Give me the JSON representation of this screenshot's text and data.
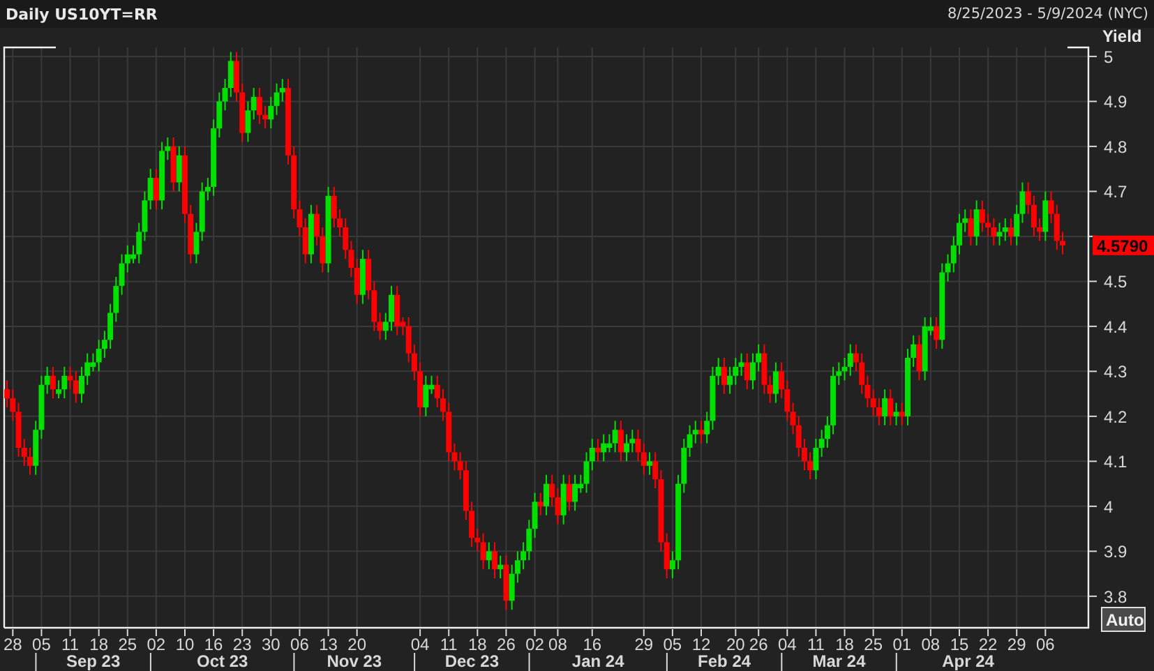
{
  "header": {
    "title": "Daily US10YT=RR",
    "range": "8/25/2023 - 5/9/2024 (NYC)"
  },
  "autoscale_button": "Auto",
  "chart_data": {
    "type": "candlestick",
    "ylabel": "Yield",
    "ylim": [
      3.73,
      5.02
    ],
    "grid": true,
    "yticks": [
      {
        "value": 3.8,
        "label": "3.8"
      },
      {
        "value": 3.9,
        "label": "3.9"
      },
      {
        "value": 4.0,
        "label": "4"
      },
      {
        "value": 4.1,
        "label": "4.1"
      },
      {
        "value": 4.2,
        "label": "4.2"
      },
      {
        "value": 4.3,
        "label": "4.3"
      },
      {
        "value": 4.4,
        "label": "4.4"
      },
      {
        "value": 4.5,
        "label": "4.5"
      },
      {
        "value": 4.7,
        "label": "4.7"
      },
      {
        "value": 4.8,
        "label": "4.8"
      },
      {
        "value": 4.9,
        "label": "4.9"
      },
      {
        "value": 5.0,
        "label": "5"
      }
    ],
    "categories": [
      null,
      "28",
      null,
      null,
      null,
      null,
      "05",
      null,
      null,
      null,
      null,
      "11",
      null,
      null,
      null,
      null,
      "18",
      null,
      null,
      null,
      null,
      "25",
      null,
      null,
      null,
      null,
      "02",
      null,
      null,
      null,
      null,
      "10",
      null,
      null,
      null,
      null,
      "16",
      null,
      null,
      null,
      null,
      "23",
      null,
      null,
      null,
      null,
      "30",
      null,
      null,
      null,
      null,
      "06",
      null,
      null,
      null,
      null,
      "13",
      null,
      null,
      null,
      null,
      "20",
      null,
      null,
      null,
      null,
      null,
      null,
      null,
      null,
      null,
      null,
      "04",
      null,
      null,
      null,
      null,
      "11",
      null,
      null,
      null,
      null,
      "18",
      null,
      null,
      null,
      null,
      "26",
      null,
      null,
      null,
      null,
      "02",
      null,
      null,
      null,
      "08",
      null,
      null,
      null,
      null,
      null,
      "16",
      null,
      null,
      null,
      null,
      null,
      null,
      null,
      null,
      "29",
      null,
      null,
      null,
      null,
      "05",
      null,
      null,
      null,
      null,
      "12",
      null,
      null,
      null,
      null,
      null,
      "20",
      null,
      null,
      null,
      "26",
      null,
      null,
      null,
      null,
      "04",
      null,
      null,
      null,
      null,
      "11",
      null,
      null,
      null,
      null,
      "18",
      null,
      null,
      null,
      null,
      "25",
      null,
      null,
      null,
      null,
      "01",
      null,
      null,
      null,
      null,
      "08",
      null,
      null,
      null,
      null,
      "15",
      null,
      null,
      null,
      null,
      "22",
      null,
      null,
      null,
      null,
      "29",
      null,
      null,
      null,
      null,
      "06",
      null,
      null,
      null
    ],
    "ohlc": [
      [
        4.26,
        4.28,
        4.22,
        4.24
      ],
      [
        4.24,
        4.26,
        4.19,
        4.21
      ],
      [
        4.21,
        4.23,
        4.11,
        4.13
      ],
      [
        4.13,
        4.15,
        4.09,
        4.11
      ],
      [
        4.11,
        4.13,
        4.07,
        4.09
      ],
      [
        4.09,
        4.19,
        4.07,
        4.17
      ],
      [
        4.17,
        4.29,
        4.15,
        4.27
      ],
      [
        4.27,
        4.31,
        4.25,
        4.29
      ],
      [
        4.29,
        4.31,
        4.24,
        4.26
      ],
      [
        4.25,
        4.28,
        4.24,
        4.26
      ],
      [
        4.26,
        4.31,
        4.24,
        4.29
      ],
      [
        4.29,
        4.31,
        4.26,
        4.28
      ],
      [
        4.28,
        4.3,
        4.23,
        4.25
      ],
      [
        4.25,
        4.31,
        4.23,
        4.29
      ],
      [
        4.29,
        4.34,
        4.27,
        4.32
      ],
      [
        4.31,
        4.34,
        4.3,
        4.32
      ],
      [
        4.32,
        4.37,
        4.3,
        4.35
      ],
      [
        4.35,
        4.39,
        4.33,
        4.37
      ],
      [
        4.37,
        4.45,
        4.35,
        4.43
      ],
      [
        4.43,
        4.51,
        4.41,
        4.49
      ],
      [
        4.49,
        4.56,
        4.47,
        4.54
      ],
      [
        4.54,
        4.58,
        4.52,
        4.56
      ],
      [
        4.55,
        4.58,
        4.54,
        4.56
      ],
      [
        4.56,
        4.63,
        4.54,
        4.61
      ],
      [
        4.61,
        4.7,
        4.59,
        4.68
      ],
      [
        4.68,
        4.75,
        4.66,
        4.73
      ],
      [
        4.73,
        4.75,
        4.66,
        4.68
      ],
      [
        4.68,
        4.81,
        4.66,
        4.79
      ],
      [
        4.79,
        4.82,
        4.77,
        4.8
      ],
      [
        4.8,
        4.82,
        4.7,
        4.72
      ],
      [
        4.72,
        4.8,
        4.7,
        4.78
      ],
      [
        4.78,
        4.8,
        4.63,
        4.65
      ],
      [
        4.65,
        4.67,
        4.54,
        4.56
      ],
      [
        4.56,
        4.63,
        4.54,
        4.61
      ],
      [
        4.61,
        4.72,
        4.59,
        4.7
      ],
      [
        4.7,
        4.73,
        4.68,
        4.71
      ],
      [
        4.71,
        4.86,
        4.69,
        4.84
      ],
      [
        4.84,
        4.92,
        4.82,
        4.9
      ],
      [
        4.9,
        4.95,
        4.88,
        4.93
      ],
      [
        4.93,
        5.01,
        4.91,
        4.99
      ],
      [
        4.99,
        5.01,
        4.9,
        4.92
      ],
      [
        4.92,
        4.94,
        4.81,
        4.83
      ],
      [
        4.83,
        4.9,
        4.81,
        4.88
      ],
      [
        4.88,
        4.93,
        4.86,
        4.91
      ],
      [
        4.91,
        4.93,
        4.85,
        4.87
      ],
      [
        4.87,
        4.89,
        4.84,
        4.86
      ],
      [
        4.86,
        4.91,
        4.84,
        4.89
      ],
      [
        4.89,
        4.94,
        4.87,
        4.92
      ],
      [
        4.92,
        4.95,
        4.9,
        4.93
      ],
      [
        4.93,
        4.95,
        4.76,
        4.78
      ],
      [
        4.78,
        4.8,
        4.64,
        4.66
      ],
      [
        4.66,
        4.68,
        4.6,
        4.62
      ],
      [
        4.62,
        4.64,
        4.54,
        4.56
      ],
      [
        4.56,
        4.67,
        4.54,
        4.65
      ],
      [
        4.65,
        4.67,
        4.58,
        4.6
      ],
      [
        4.6,
        4.62,
        4.52,
        4.54
      ],
      [
        4.54,
        4.71,
        4.52,
        4.69
      ],
      [
        4.69,
        4.71,
        4.62,
        4.64
      ],
      [
        4.64,
        4.66,
        4.6,
        4.62
      ],
      [
        4.62,
        4.64,
        4.55,
        4.57
      ],
      [
        4.57,
        4.59,
        4.51,
        4.53
      ],
      [
        4.53,
        4.55,
        4.45,
        4.47
      ],
      [
        4.47,
        4.57,
        4.45,
        4.55
      ],
      [
        4.55,
        4.57,
        4.46,
        4.48
      ],
      [
        4.48,
        4.5,
        4.39,
        4.41
      ],
      [
        4.41,
        4.43,
        4.37,
        4.39
      ],
      [
        4.39,
        4.43,
        4.37,
        4.41
      ],
      [
        4.41,
        4.49,
        4.39,
        4.47
      ],
      [
        4.47,
        4.49,
        4.38,
        4.4
      ],
      [
        4.41,
        4.42,
        4.38,
        4.4
      ],
      [
        4.4,
        4.42,
        4.32,
        4.34
      ],
      [
        4.34,
        4.36,
        4.28,
        4.3
      ],
      [
        4.3,
        4.32,
        4.2,
        4.22
      ],
      [
        4.22,
        4.29,
        4.2,
        4.27
      ],
      [
        4.26,
        4.29,
        4.25,
        4.27
      ],
      [
        4.27,
        4.29,
        4.22,
        4.24
      ],
      [
        4.24,
        4.26,
        4.19,
        4.21
      ],
      [
        4.21,
        4.23,
        4.1,
        4.12
      ],
      [
        4.12,
        4.14,
        4.08,
        4.1
      ],
      [
        4.1,
        4.12,
        4.06,
        4.08
      ],
      [
        4.08,
        4.1,
        3.97,
        3.99
      ],
      [
        3.99,
        4.01,
        3.91,
        3.93
      ],
      [
        3.93,
        3.95,
        3.9,
        3.92
      ],
      [
        3.92,
        3.94,
        3.86,
        3.88
      ],
      [
        3.88,
        3.92,
        3.86,
        3.9
      ],
      [
        3.9,
        3.92,
        3.84,
        3.86
      ],
      [
        3.86,
        3.89,
        3.84,
        3.87
      ],
      [
        3.87,
        3.89,
        3.77,
        3.79
      ],
      [
        3.79,
        3.87,
        3.77,
        3.85
      ],
      [
        3.85,
        3.9,
        3.83,
        3.88
      ],
      [
        3.88,
        3.92,
        3.86,
        3.9
      ],
      [
        3.9,
        3.97,
        3.88,
        3.95
      ],
      [
        3.95,
        4.03,
        3.93,
        4.01
      ],
      [
        4.01,
        4.03,
        3.98,
        4.0
      ],
      [
        4.0,
        4.07,
        3.98,
        4.05
      ],
      [
        4.05,
        4.07,
        4.0,
        4.02
      ],
      [
        4.02,
        4.04,
        3.96,
        3.98
      ],
      [
        3.98,
        4.07,
        3.96,
        4.05
      ],
      [
        4.05,
        4.07,
        3.99,
        4.01
      ],
      [
        4.01,
        4.07,
        3.99,
        4.05
      ],
      [
        4.04,
        4.07,
        4.03,
        4.05
      ],
      [
        4.05,
        4.12,
        4.03,
        4.1
      ],
      [
        4.1,
        4.15,
        4.08,
        4.13
      ],
      [
        4.13,
        4.15,
        4.1,
        4.12
      ],
      [
        4.12,
        4.16,
        4.1,
        4.14
      ],
      [
        4.13,
        4.16,
        4.12,
        4.14
      ],
      [
        4.14,
        4.19,
        4.12,
        4.17
      ],
      [
        4.17,
        4.19,
        4.1,
        4.12
      ],
      [
        4.12,
        4.16,
        4.1,
        4.14
      ],
      [
        4.14,
        4.17,
        4.12,
        4.15
      ],
      [
        4.15,
        4.17,
        4.1,
        4.12
      ],
      [
        4.12,
        4.14,
        4.07,
        4.09
      ],
      [
        4.09,
        4.12,
        4.07,
        4.1
      ],
      [
        4.1,
        4.12,
        4.04,
        4.06
      ],
      [
        4.06,
        4.08,
        3.9,
        3.92
      ],
      [
        3.92,
        3.94,
        3.84,
        3.86
      ],
      [
        3.86,
        3.9,
        3.84,
        3.88
      ],
      [
        3.88,
        4.07,
        3.86,
        4.05
      ],
      [
        4.05,
        4.15,
        4.03,
        4.13
      ],
      [
        4.13,
        4.18,
        4.11,
        4.16
      ],
      [
        4.16,
        4.19,
        4.14,
        4.17
      ],
      [
        4.17,
        4.19,
        4.14,
        4.16
      ],
      [
        4.16,
        4.21,
        4.14,
        4.19
      ],
      [
        4.19,
        4.31,
        4.17,
        4.29
      ],
      [
        4.29,
        4.33,
        4.27,
        4.31
      ],
      [
        4.31,
        4.33,
        4.25,
        4.27
      ],
      [
        4.27,
        4.31,
        4.25,
        4.29
      ],
      [
        4.29,
        4.33,
        4.27,
        4.31
      ],
      [
        4.31,
        4.34,
        4.29,
        4.32
      ],
      [
        4.32,
        4.34,
        4.26,
        4.28
      ],
      [
        4.28,
        4.34,
        4.26,
        4.32
      ],
      [
        4.32,
        4.36,
        4.3,
        4.34
      ],
      [
        4.34,
        4.36,
        4.25,
        4.27
      ],
      [
        4.27,
        4.29,
        4.23,
        4.25
      ],
      [
        4.25,
        4.32,
        4.23,
        4.3
      ],
      [
        4.3,
        4.32,
        4.24,
        4.26
      ],
      [
        4.26,
        4.28,
        4.19,
        4.21
      ],
      [
        4.21,
        4.23,
        4.16,
        4.18
      ],
      [
        4.18,
        4.2,
        4.11,
        4.13
      ],
      [
        4.13,
        4.15,
        4.08,
        4.1
      ],
      [
        4.1,
        4.12,
        4.06,
        4.08
      ],
      [
        4.08,
        4.15,
        4.06,
        4.13
      ],
      [
        4.13,
        4.17,
        4.11,
        4.15
      ],
      [
        4.15,
        4.2,
        4.13,
        4.18
      ],
      [
        4.18,
        4.31,
        4.16,
        4.29
      ],
      [
        4.29,
        4.32,
        4.27,
        4.3
      ],
      [
        4.3,
        4.33,
        4.28,
        4.31
      ],
      [
        4.31,
        4.36,
        4.29,
        4.34
      ],
      [
        4.34,
        4.36,
        4.3,
        4.32
      ],
      [
        4.32,
        4.34,
        4.25,
        4.27
      ],
      [
        4.27,
        4.29,
        4.22,
        4.24
      ],
      [
        4.24,
        4.26,
        4.2,
        4.22
      ],
      [
        4.22,
        4.24,
        4.18,
        4.2
      ],
      [
        4.2,
        4.26,
        4.18,
        4.24
      ],
      [
        4.24,
        4.26,
        4.18,
        4.2
      ],
      [
        4.2,
        4.23,
        4.18,
        4.21
      ],
      [
        4.21,
        4.23,
        4.18,
        4.2
      ],
      [
        4.2,
        4.35,
        4.18,
        4.33
      ],
      [
        4.33,
        4.38,
        4.31,
        4.36
      ],
      [
        4.36,
        4.38,
        4.28,
        4.3
      ],
      [
        4.3,
        4.42,
        4.28,
        4.4
      ],
      [
        4.39,
        4.42,
        4.38,
        4.4
      ],
      [
        4.4,
        4.42,
        4.35,
        4.37
      ],
      [
        4.37,
        4.54,
        4.35,
        4.52
      ],
      [
        4.52,
        4.56,
        4.5,
        4.54
      ],
      [
        4.54,
        4.6,
        4.52,
        4.58
      ],
      [
        4.58,
        4.65,
        4.56,
        4.63
      ],
      [
        4.63,
        4.66,
        4.61,
        4.64
      ],
      [
        4.64,
        4.66,
        4.58,
        4.6
      ],
      [
        4.6,
        4.68,
        4.58,
        4.66
      ],
      [
        4.66,
        4.68,
        4.61,
        4.63
      ],
      [
        4.63,
        4.65,
        4.6,
        4.62
      ],
      [
        4.62,
        4.64,
        4.58,
        4.6
      ],
      [
        4.6,
        4.63,
        4.58,
        4.61
      ],
      [
        4.61,
        4.64,
        4.59,
        4.62
      ],
      [
        4.62,
        4.64,
        4.58,
        4.6
      ],
      [
        4.6,
        4.67,
        4.58,
        4.65
      ],
      [
        4.65,
        4.72,
        4.63,
        4.7
      ],
      [
        4.7,
        4.72,
        4.65,
        4.67
      ],
      [
        4.67,
        4.69,
        4.6,
        4.62
      ],
      [
        4.62,
        4.64,
        4.59,
        4.61
      ],
      [
        4.61,
        4.7,
        4.59,
        4.68
      ],
      [
        4.68,
        4.7,
        4.63,
        4.65
      ],
      [
        4.65,
        4.67,
        4.57,
        4.59
      ],
      [
        4.59,
        4.61,
        4.56,
        4.58
      ]
    ],
    "annotations": [
      "4.5790"
    ]
  },
  "month_labels": [
    "Sep 23",
    "Oct 23",
    "Nov 23",
    "Dec 23",
    "Jan 24",
    "Feb 24",
    "Mar 24",
    "Apr 24"
  ]
}
